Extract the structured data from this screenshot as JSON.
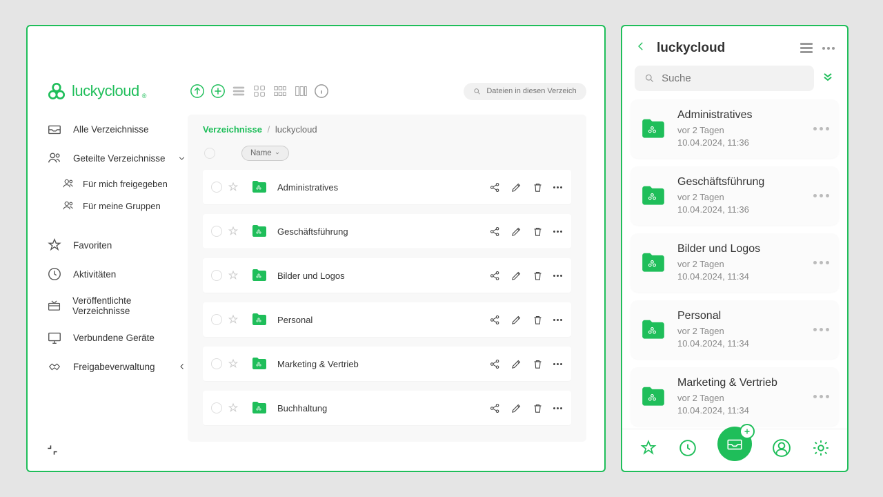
{
  "brand": {
    "name": "luckycloud"
  },
  "desktop": {
    "search": {
      "placeholder": "Dateien in diesen Verzeichnissen"
    },
    "sidebar": {
      "items": [
        {
          "label": "Alle Verzeichnisse"
        },
        {
          "label": "Geteilte Verzeichnisse"
        },
        {
          "label": "Für mich freigegeben"
        },
        {
          "label": "Für meine Gruppen"
        },
        {
          "label": "Favoriten"
        },
        {
          "label": "Aktivitäten"
        },
        {
          "label": "Veröffentlichte Verzeichnisse"
        },
        {
          "label": "Verbundene Geräte"
        },
        {
          "label": "Freigabeverwaltung"
        }
      ]
    },
    "breadcrumb": {
      "root": "Verzeichnisse",
      "leaf": "luckycloud"
    },
    "sort": {
      "label": "Name"
    },
    "files": [
      {
        "name": "Administratives"
      },
      {
        "name": "Geschäftsführung"
      },
      {
        "name": "Bilder und Logos"
      },
      {
        "name": "Personal"
      },
      {
        "name": "Marketing & Vertrieb"
      },
      {
        "name": "Buchhaltung"
      }
    ]
  },
  "mobile": {
    "title": "luckycloud",
    "search": {
      "placeholder": "Suche"
    },
    "items": [
      {
        "name": "Administratives",
        "ago": "vor 2 Tagen",
        "date": "10.04.2024, 11:36"
      },
      {
        "name": "Geschäftsführung",
        "ago": "vor 2 Tagen",
        "date": "10.04.2024, 11:36"
      },
      {
        "name": "Bilder und Logos",
        "ago": "vor 2 Tagen",
        "date": "10.04.2024, 11:34"
      },
      {
        "name": "Personal",
        "ago": "vor 2 Tagen",
        "date": "10.04.2024, 11:34"
      },
      {
        "name": "Marketing & Vertrieb",
        "ago": "vor 2 Tagen",
        "date": "10.04.2024, 11:34"
      }
    ]
  }
}
